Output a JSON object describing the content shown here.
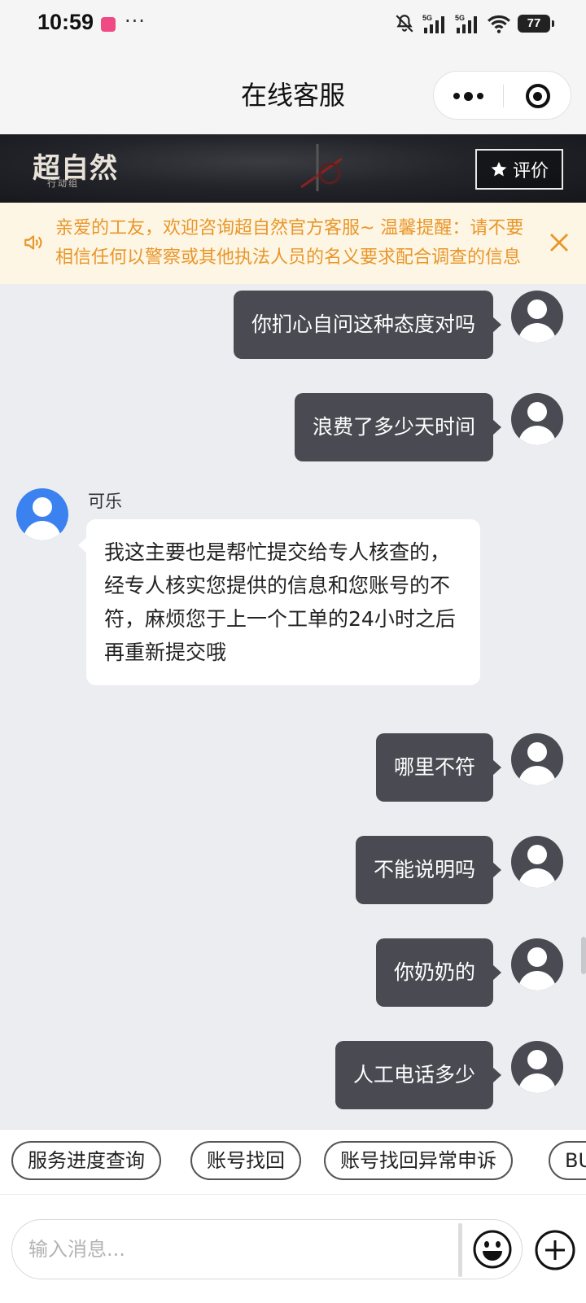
{
  "status_bar": {
    "time": "10:59",
    "more": "···",
    "battery": "77",
    "signal_1": "5G",
    "signal_2": "5G",
    "icons": [
      "notify-app-icon",
      "mute-bell-icon",
      "signal-5g-icon",
      "signal-5g-icon",
      "wifi-icon",
      "battery-icon"
    ]
  },
  "nav": {
    "title": "在线客服"
  },
  "banner": {
    "logo": "超自然",
    "logo_sub": "行动组",
    "rate_label": "评价"
  },
  "notice": {
    "text": "亲爱的工友，欢迎咨询超自然官方客服~ 温馨提醒：请不要相信任何以警察或其他执法人员的名义要求配合调查的信息"
  },
  "messages": [
    {
      "from": "user",
      "text": "你扪心自问这种态度对吗"
    },
    {
      "from": "user",
      "text": "浪费了多少天时间"
    },
    {
      "from": "agent",
      "name": "可乐",
      "text": "我这主要也是帮忙提交给专人核查的，经专人核实您提供的信息和您账号的不符，麻烦您于上一个工单的24小时之后再重新提交哦"
    },
    {
      "from": "user",
      "text": "哪里不符"
    },
    {
      "from": "user",
      "text": "不能说明吗"
    },
    {
      "from": "user",
      "text": "你奶奶的"
    },
    {
      "from": "user",
      "text": "人工电话多少"
    }
  ],
  "quick_replies": [
    "服务进度查询",
    "账号找回",
    "账号找回异常申诉",
    "BUG反馈"
  ],
  "input": {
    "placeholder": "输入消息...",
    "value": ""
  },
  "colors": {
    "user_bubble": "#4a4b52",
    "agent_avatar": "#3b82f0",
    "notice_text": "#e8962a",
    "notice_bg": "#fef6e4",
    "chat_bg": "#ebedf0"
  }
}
